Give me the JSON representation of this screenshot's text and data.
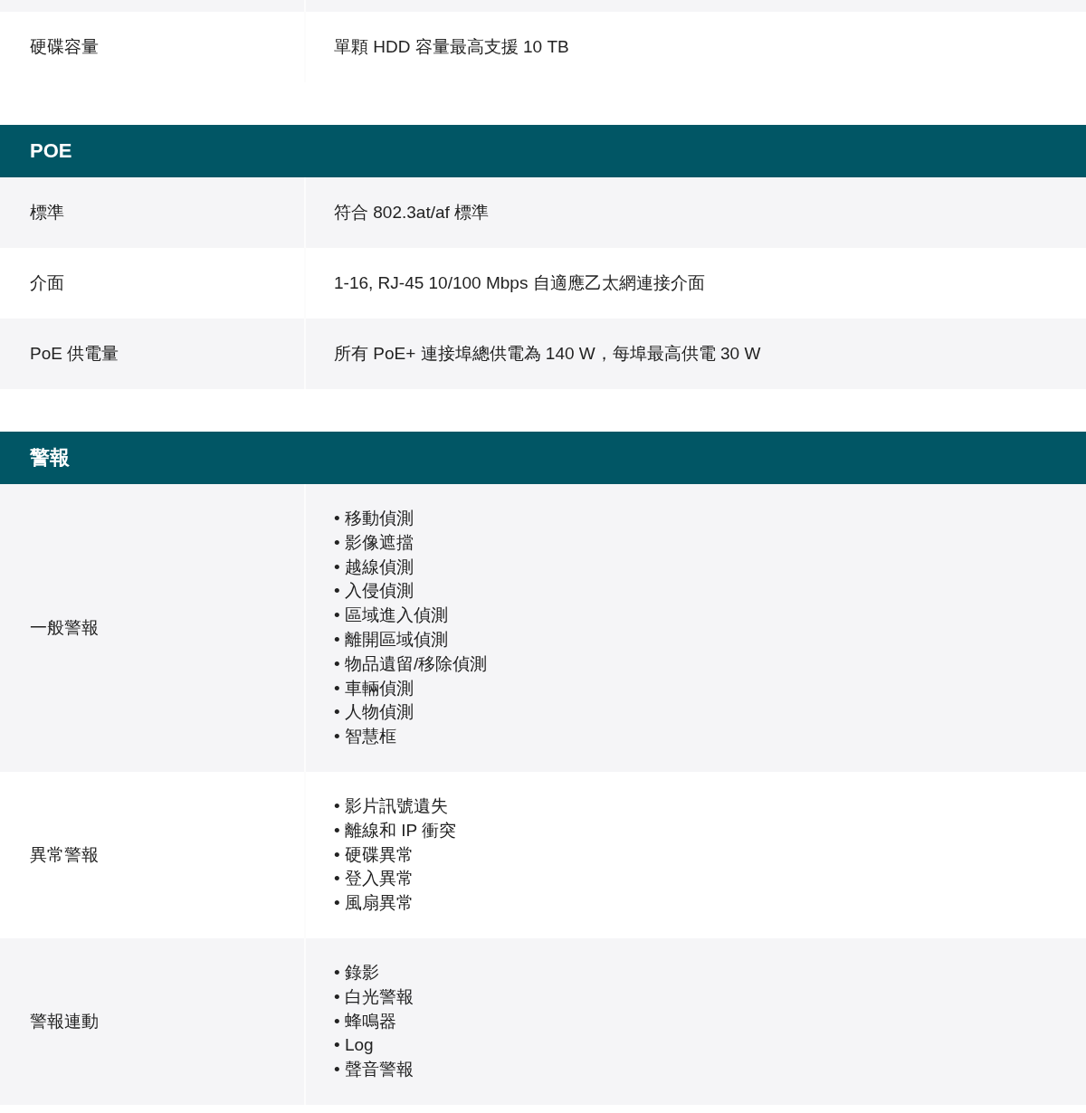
{
  "sections": [
    {
      "rows": [
        {
          "label": "硬碟容量",
          "value": "單顆 HDD 容量最高支援 10 TB"
        }
      ]
    },
    {
      "title": "POE",
      "rows": [
        {
          "label": "標準",
          "value": "符合 802.3at/af 標準"
        },
        {
          "label": "介面",
          "value": "1-16, RJ-45 10/100 Mbps 自適應乙太網連接介面"
        },
        {
          "label": "PoE 供電量",
          "value": "所有 PoE+ 連接埠總供電為 140 W，每埠最高供電 30 W"
        }
      ]
    },
    {
      "title": "警報",
      "rows": [
        {
          "label": "一般警報",
          "items": [
            "• 移動偵測",
            "• 影像遮擋",
            "• 越線偵測",
            "• 入侵偵測",
            "• 區域進入偵測",
            "• 離開區域偵測",
            "• 物品遺留/移除偵測",
            "• 車輛偵測",
            "• 人物偵測",
            "• 智慧框"
          ]
        },
        {
          "label": "異常警報",
          "items": [
            "• 影片訊號遺失",
            "• 離線和 IP 衝突",
            "• 硬碟異常",
            "• 登入異常",
            "• 風扇異常"
          ]
        },
        {
          "label": "警報連動",
          "items": [
            "• 錄影",
            "• 白光警報",
            "• 蜂鳴器",
            "• Log",
            "• 聲音警報"
          ]
        }
      ]
    }
  ]
}
